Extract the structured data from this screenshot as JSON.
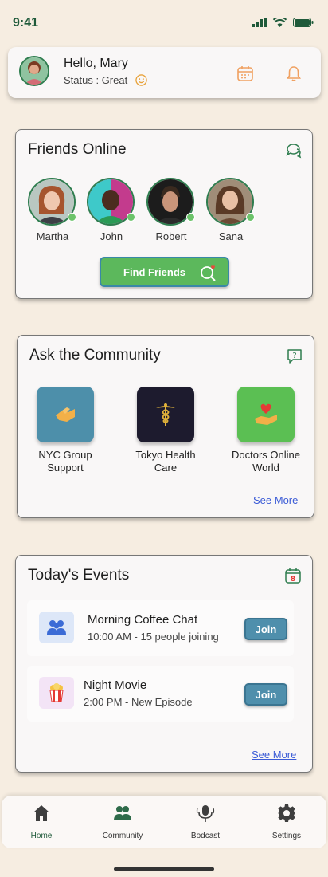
{
  "status_bar": {
    "time": "9:41"
  },
  "header": {
    "greeting": "Hello, Mary",
    "status_text": "Status : Great"
  },
  "friends": {
    "title": "Friends Online",
    "items": [
      {
        "name": "Martha",
        "online": true
      },
      {
        "name": "John",
        "online": true
      },
      {
        "name": "Robert",
        "online": true
      },
      {
        "name": "Sana",
        "online": true
      }
    ],
    "button_label": "Find Friends"
  },
  "community": {
    "title": "Ask the Community",
    "items": [
      {
        "line1": "NYC Group",
        "line2": "Support",
        "icon": "handshake-icon",
        "color": "#4d8faa"
      },
      {
        "line1": "Tokyo Health",
        "line2": "Care",
        "icon": "caduceus-icon",
        "color": "#1d1b2e"
      },
      {
        "line1": "Doctors Online",
        "line2": "World",
        "icon": "heart-hand-icon",
        "color": "#5bbf53"
      }
    ],
    "see_more": "See More"
  },
  "events": {
    "title": "Today's Events",
    "calendar_day": "8",
    "items": [
      {
        "title": "Morning Coffee Chat",
        "subtitle": "10:00 AM - 15 people joining",
        "button": "Join",
        "icon": "people-icon"
      },
      {
        "title": "Night Movie",
        "subtitle": "2:00 PM - New Episode",
        "button": "Join",
        "icon": "popcorn-icon"
      }
    ],
    "see_more": "See More"
  },
  "nav": {
    "items": [
      {
        "label": "Home",
        "icon": "home-icon",
        "active": true
      },
      {
        "label": "Community",
        "icon": "community-icon",
        "active": false
      },
      {
        "label": "Bodcast",
        "icon": "microphone-icon",
        "active": false
      },
      {
        "label": "Settings",
        "icon": "gear-icon",
        "active": false
      }
    ]
  },
  "colors": {
    "background": "#f6ede1",
    "accent_green": "#5cb85c",
    "dark_green": "#1f5a3a",
    "join_blue": "#4f8fac",
    "link_blue": "#3b5bd6",
    "header_icon_orange": "#f0a060"
  }
}
